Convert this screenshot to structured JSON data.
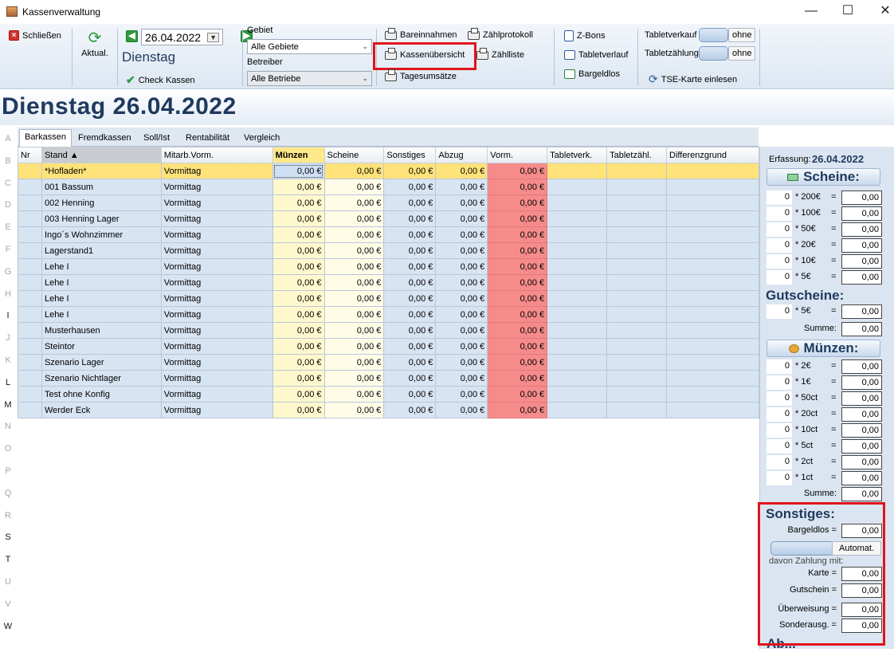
{
  "window": {
    "title": "Kassenverwaltung",
    "controls": [
      "—",
      "☐",
      "✕"
    ]
  },
  "toolbar": {
    "close_label": "Schließen",
    "refresh_label": "Aktual.",
    "date_value": "26.04.2022",
    "weekday": "Dienstag",
    "check_label": "Check Kassen",
    "gebiet_label": "Gebiet",
    "gebiet_value": "Alle Gebiete",
    "betreiber_label": "Betreiber",
    "betreiber_value": "Alle Betriebe",
    "bareinnahmen": "Bareinnahmen",
    "kassenuebersicht": "Kassenübersicht",
    "tagesumsaetze": "Tagesumsätze",
    "zaehlprotokoll": "Zählprotokoll",
    "zaehlliste": "Zählliste",
    "zbons": "Z-Bons",
    "tabletverlauf": "Tabletverlauf",
    "bargeldlos": "Bargeldlos",
    "tabletverkauf_label": "Tabletverkauf",
    "tabletzaehlung_label": "Tabletzählung",
    "ohne": "ohne",
    "tse_label": "TSE-Karte einlesen"
  },
  "banner": {
    "title": "Dienstag 26.04.2022"
  },
  "row_letters": [
    "A",
    "B",
    "C",
    "D",
    "E",
    "F",
    "G",
    "H",
    "I",
    "J",
    "K",
    "L",
    "M",
    "N",
    "O",
    "P",
    "Q",
    "R",
    "S",
    "T",
    "U",
    "V",
    "W"
  ],
  "tabs": [
    "Barkassen",
    "Fremdkassen",
    "Soll/Ist",
    "Rentabilität",
    "Vergleich"
  ],
  "table": {
    "columns": [
      "Nr",
      "Stand ▲",
      "Mitarb.Vorm.",
      "Münzen",
      "Scheine",
      "Sonstiges",
      "Abzug",
      "Vorm.",
      "Tabletverk.",
      "Tabletzähl.",
      "Differenzgrund"
    ],
    "rows": [
      {
        "nr": "",
        "stand": "*Hofladen*",
        "mitarb": "Vormittag",
        "muenzen": "0,00 €",
        "scheine": "0,00 €",
        "sonstiges": "0,00 €",
        "abzug": "0,00 €",
        "vorm": "0,00 €"
      },
      {
        "nr": "",
        "stand": "001 Bassum",
        "mitarb": "Vormittag",
        "muenzen": "0,00 €",
        "scheine": "0,00 €",
        "sonstiges": "0,00 €",
        "abzug": "0,00 €",
        "vorm": "0,00 €"
      },
      {
        "nr": "",
        "stand": "002 Henning",
        "mitarb": "Vormittag",
        "muenzen": "0,00 €",
        "scheine": "0,00 €",
        "sonstiges": "0,00 €",
        "abzug": "0,00 €",
        "vorm": "0,00 €"
      },
      {
        "nr": "",
        "stand": "003 Henning Lager",
        "mitarb": "Vormittag",
        "muenzen": "0,00 €",
        "scheine": "0,00 €",
        "sonstiges": "0,00 €",
        "abzug": "0,00 €",
        "vorm": "0,00 €"
      },
      {
        "nr": "",
        "stand": "Ingo´s Wohnzimmer",
        "mitarb": "Vormittag",
        "muenzen": "0,00 €",
        "scheine": "0,00 €",
        "sonstiges": "0,00 €",
        "abzug": "0,00 €",
        "vorm": "0,00 €"
      },
      {
        "nr": "",
        "stand": "Lagerstand1",
        "mitarb": "Vormittag",
        "muenzen": "0,00 €",
        "scheine": "0,00 €",
        "sonstiges": "0,00 €",
        "abzug": "0,00 €",
        "vorm": "0,00 €"
      },
      {
        "nr": "",
        "stand": "Lehe I",
        "mitarb": "Vormittag",
        "muenzen": "0,00 €",
        "scheine": "0,00 €",
        "sonstiges": "0,00 €",
        "abzug": "0,00 €",
        "vorm": "0,00 €"
      },
      {
        "nr": "",
        "stand": "Lehe I",
        "mitarb": "Vormittag",
        "muenzen": "0,00 €",
        "scheine": "0,00 €",
        "sonstiges": "0,00 €",
        "abzug": "0,00 €",
        "vorm": "0,00 €"
      },
      {
        "nr": "",
        "stand": "Lehe I",
        "mitarb": "Vormittag",
        "muenzen": "0,00 €",
        "scheine": "0,00 €",
        "sonstiges": "0,00 €",
        "abzug": "0,00 €",
        "vorm": "0,00 €"
      },
      {
        "nr": "",
        "stand": "Lehe I",
        "mitarb": "Vormittag",
        "muenzen": "0,00 €",
        "scheine": "0,00 €",
        "sonstiges": "0,00 €",
        "abzug": "0,00 €",
        "vorm": "0,00 €"
      },
      {
        "nr": "",
        "stand": "Musterhausen",
        "mitarb": "Vormittag",
        "muenzen": "0,00 €",
        "scheine": "0,00 €",
        "sonstiges": "0,00 €",
        "abzug": "0,00 €",
        "vorm": "0,00 €"
      },
      {
        "nr": "",
        "stand": "Steintor",
        "mitarb": "Vormittag",
        "muenzen": "0,00 €",
        "scheine": "0,00 €",
        "sonstiges": "0,00 €",
        "abzug": "0,00 €",
        "vorm": "0,00 €"
      },
      {
        "nr": "",
        "stand": "Szenario Lager",
        "mitarb": "Vormittag",
        "muenzen": "0,00 €",
        "scheine": "0,00 €",
        "sonstiges": "0,00 €",
        "abzug": "0,00 €",
        "vorm": "0,00 €"
      },
      {
        "nr": "",
        "stand": "Szenario Nichtlager",
        "mitarb": "Vormittag",
        "muenzen": "0,00 €",
        "scheine": "0,00 €",
        "sonstiges": "0,00 €",
        "abzug": "0,00 €",
        "vorm": "0,00 €"
      },
      {
        "nr": "",
        "stand": "Test ohne Konfig",
        "mitarb": "Vormittag",
        "muenzen": "0,00 €",
        "scheine": "0,00 €",
        "sonstiges": "0,00 €",
        "abzug": "0,00 €",
        "vorm": "0,00 €"
      },
      {
        "nr": "",
        "stand": "Werder Eck",
        "mitarb": "Vormittag",
        "muenzen": "0,00 €",
        "scheine": "0,00 €",
        "sonstiges": "0,00 €",
        "abzug": "0,00 €",
        "vorm": "0,00 €"
      }
    ]
  },
  "panel": {
    "erfassung_label": "Erfassung:",
    "erfassung_date": "26.04.2022",
    "scheine_title": "Scheine:",
    "scheine": [
      {
        "count": "0",
        "denom": "* 200€",
        "value": "0,00"
      },
      {
        "count": "0",
        "denom": "* 100€",
        "value": "0,00"
      },
      {
        "count": "0",
        "denom": "* 50€",
        "value": "0,00"
      },
      {
        "count": "0",
        "denom": "* 20€",
        "value": "0,00"
      },
      {
        "count": "0",
        "denom": "* 10€",
        "value": "0,00"
      },
      {
        "count": "0",
        "denom": "* 5€",
        "value": "0,00"
      }
    ],
    "gutscheine_title": "Gutscheine:",
    "gutscheine": {
      "count": "0",
      "denom": "* 5€",
      "value": "0,00"
    },
    "summe_label": "Summe:",
    "gutscheine_summe": "0,00",
    "muenzen_title": "Münzen:",
    "muenzen": [
      {
        "count": "0",
        "denom": "* 2€",
        "value": "0,00"
      },
      {
        "count": "0",
        "denom": "* 1€",
        "value": "0,00"
      },
      {
        "count": "0",
        "denom": "* 50ct",
        "value": "0,00"
      },
      {
        "count": "0",
        "denom": "* 20ct",
        "value": "0,00"
      },
      {
        "count": "0",
        "denom": "* 10ct",
        "value": "0,00"
      },
      {
        "count": "0",
        "denom": "* 5ct",
        "value": "0,00"
      },
      {
        "count": "0",
        "denom": "* 2ct",
        "value": "0,00"
      },
      {
        "count": "0",
        "denom": "* 1ct",
        "value": "0,00"
      }
    ],
    "muenzen_summe": "0,00",
    "sonstiges_title": "Sonstiges:",
    "bargeldlos_label": "Bargeldlos =",
    "bargeldlos_value": "0,00",
    "automat_label": "Automat.",
    "davon_label": "davon Zahlung mit:",
    "karte_label": "Karte =",
    "karte_value": "0,00",
    "gutschein_label": "Gutschein =",
    "gutschein_value": "0,00",
    "ueberweisung_label": "Überweisung =",
    "ueberweisung_value": "0,00",
    "sonderausg_label": "Sonderausg. =",
    "sonderausg_value": "0,00",
    "cut_off_label": "Ab..."
  }
}
